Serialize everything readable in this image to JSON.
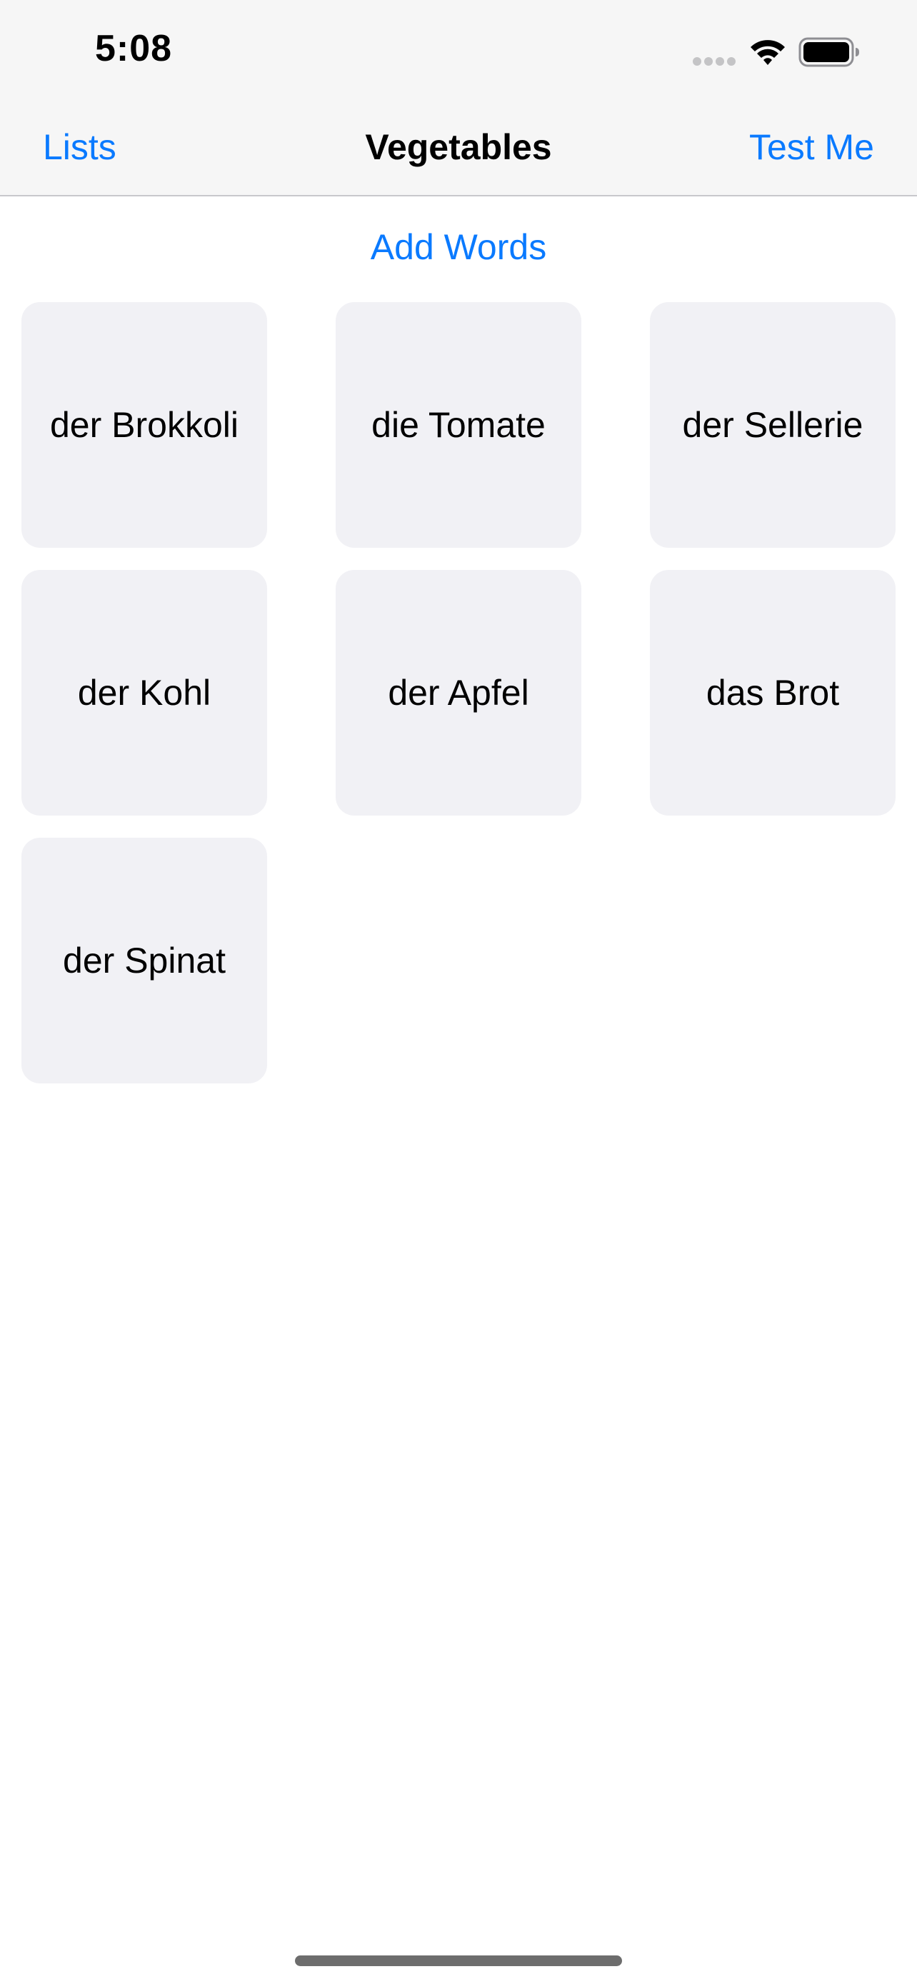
{
  "status_bar": {
    "time": "5:08",
    "icons": [
      "signal-dots-icon",
      "wifi-icon",
      "battery-icon"
    ]
  },
  "nav": {
    "back_label": "Lists",
    "title": "Vegetables",
    "action_label": "Test Me"
  },
  "add_words_label": "Add Words",
  "cards": [
    {
      "label": "der Brokkoli"
    },
    {
      "label": "die Tomate"
    },
    {
      "label": "der Sellerie"
    },
    {
      "label": "der Kohl"
    },
    {
      "label": "der Apfel"
    },
    {
      "label": "das Brot"
    },
    {
      "label": "der Spinat"
    }
  ],
  "colors": {
    "accent": "#0a7aff",
    "card_background": "#f1f1f5",
    "bar_background": "#f6f6f6"
  }
}
